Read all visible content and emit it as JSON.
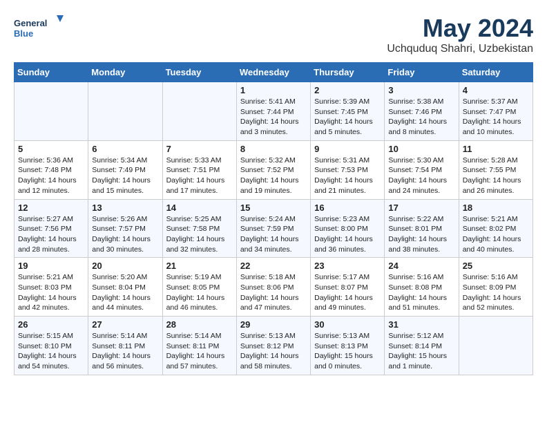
{
  "logo": {
    "line1": "General",
    "line2": "Blue"
  },
  "title": "May 2024",
  "subtitle": "Uchquduq Shahri, Uzbekistan",
  "days_header": [
    "Sunday",
    "Monday",
    "Tuesday",
    "Wednesday",
    "Thursday",
    "Friday",
    "Saturday"
  ],
  "weeks": [
    {
      "cells": [
        {
          "day": "",
          "content": ""
        },
        {
          "day": "",
          "content": ""
        },
        {
          "day": "",
          "content": ""
        },
        {
          "day": "1",
          "content": "Sunrise: 5:41 AM\nSunset: 7:44 PM\nDaylight: 14 hours\nand 3 minutes."
        },
        {
          "day": "2",
          "content": "Sunrise: 5:39 AM\nSunset: 7:45 PM\nDaylight: 14 hours\nand 5 minutes."
        },
        {
          "day": "3",
          "content": "Sunrise: 5:38 AM\nSunset: 7:46 PM\nDaylight: 14 hours\nand 8 minutes."
        },
        {
          "day": "4",
          "content": "Sunrise: 5:37 AM\nSunset: 7:47 PM\nDaylight: 14 hours\nand 10 minutes."
        }
      ]
    },
    {
      "cells": [
        {
          "day": "5",
          "content": "Sunrise: 5:36 AM\nSunset: 7:48 PM\nDaylight: 14 hours\nand 12 minutes."
        },
        {
          "day": "6",
          "content": "Sunrise: 5:34 AM\nSunset: 7:49 PM\nDaylight: 14 hours\nand 15 minutes."
        },
        {
          "day": "7",
          "content": "Sunrise: 5:33 AM\nSunset: 7:51 PM\nDaylight: 14 hours\nand 17 minutes."
        },
        {
          "day": "8",
          "content": "Sunrise: 5:32 AM\nSunset: 7:52 PM\nDaylight: 14 hours\nand 19 minutes."
        },
        {
          "day": "9",
          "content": "Sunrise: 5:31 AM\nSunset: 7:53 PM\nDaylight: 14 hours\nand 21 minutes."
        },
        {
          "day": "10",
          "content": "Sunrise: 5:30 AM\nSunset: 7:54 PM\nDaylight: 14 hours\nand 24 minutes."
        },
        {
          "day": "11",
          "content": "Sunrise: 5:28 AM\nSunset: 7:55 PM\nDaylight: 14 hours\nand 26 minutes."
        }
      ]
    },
    {
      "cells": [
        {
          "day": "12",
          "content": "Sunrise: 5:27 AM\nSunset: 7:56 PM\nDaylight: 14 hours\nand 28 minutes."
        },
        {
          "day": "13",
          "content": "Sunrise: 5:26 AM\nSunset: 7:57 PM\nDaylight: 14 hours\nand 30 minutes."
        },
        {
          "day": "14",
          "content": "Sunrise: 5:25 AM\nSunset: 7:58 PM\nDaylight: 14 hours\nand 32 minutes."
        },
        {
          "day": "15",
          "content": "Sunrise: 5:24 AM\nSunset: 7:59 PM\nDaylight: 14 hours\nand 34 minutes."
        },
        {
          "day": "16",
          "content": "Sunrise: 5:23 AM\nSunset: 8:00 PM\nDaylight: 14 hours\nand 36 minutes."
        },
        {
          "day": "17",
          "content": "Sunrise: 5:22 AM\nSunset: 8:01 PM\nDaylight: 14 hours\nand 38 minutes."
        },
        {
          "day": "18",
          "content": "Sunrise: 5:21 AM\nSunset: 8:02 PM\nDaylight: 14 hours\nand 40 minutes."
        }
      ]
    },
    {
      "cells": [
        {
          "day": "19",
          "content": "Sunrise: 5:21 AM\nSunset: 8:03 PM\nDaylight: 14 hours\nand 42 minutes."
        },
        {
          "day": "20",
          "content": "Sunrise: 5:20 AM\nSunset: 8:04 PM\nDaylight: 14 hours\nand 44 minutes."
        },
        {
          "day": "21",
          "content": "Sunrise: 5:19 AM\nSunset: 8:05 PM\nDaylight: 14 hours\nand 46 minutes."
        },
        {
          "day": "22",
          "content": "Sunrise: 5:18 AM\nSunset: 8:06 PM\nDaylight: 14 hours\nand 47 minutes."
        },
        {
          "day": "23",
          "content": "Sunrise: 5:17 AM\nSunset: 8:07 PM\nDaylight: 14 hours\nand 49 minutes."
        },
        {
          "day": "24",
          "content": "Sunrise: 5:16 AM\nSunset: 8:08 PM\nDaylight: 14 hours\nand 51 minutes."
        },
        {
          "day": "25",
          "content": "Sunrise: 5:16 AM\nSunset: 8:09 PM\nDaylight: 14 hours\nand 52 minutes."
        }
      ]
    },
    {
      "cells": [
        {
          "day": "26",
          "content": "Sunrise: 5:15 AM\nSunset: 8:10 PM\nDaylight: 14 hours\nand 54 minutes."
        },
        {
          "day": "27",
          "content": "Sunrise: 5:14 AM\nSunset: 8:11 PM\nDaylight: 14 hours\nand 56 minutes."
        },
        {
          "day": "28",
          "content": "Sunrise: 5:14 AM\nSunset: 8:11 PM\nDaylight: 14 hours\nand 57 minutes."
        },
        {
          "day": "29",
          "content": "Sunrise: 5:13 AM\nSunset: 8:12 PM\nDaylight: 14 hours\nand 58 minutes."
        },
        {
          "day": "30",
          "content": "Sunrise: 5:13 AM\nSunset: 8:13 PM\nDaylight: 15 hours\nand 0 minutes."
        },
        {
          "day": "31",
          "content": "Sunrise: 5:12 AM\nSunset: 8:14 PM\nDaylight: 15 hours\nand 1 minute."
        },
        {
          "day": "",
          "content": ""
        }
      ]
    }
  ]
}
